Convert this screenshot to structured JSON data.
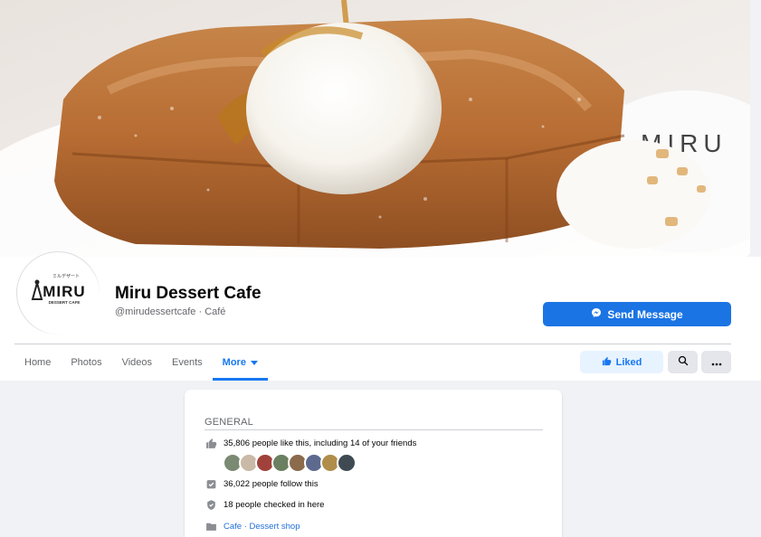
{
  "cover": {
    "plate_text": "MIRU"
  },
  "profile": {
    "logo_text": "MIRU",
    "logo_subtext": "DESSERT CAFE",
    "logo_kana": "ミルデザート",
    "name": "Miru Dessert Cafe",
    "handle": "@mirudessertcafe · Café"
  },
  "actions": {
    "send_message": "Send Message",
    "liked": "Liked",
    "search_icon": "search-icon",
    "more_icon": "more-dots-icon"
  },
  "tabs": [
    {
      "label": "Home"
    },
    {
      "label": "Photos"
    },
    {
      "label": "Videos"
    },
    {
      "label": "Events"
    },
    {
      "label": "More",
      "active": true
    }
  ],
  "about": {
    "title": "GENERAL",
    "likes": "35,806 people like this, including 14 of your friends",
    "follows": "36,022 people follow this",
    "checkins": "18 people checked in here",
    "category_1": "Cafe",
    "category_sep": " · ",
    "category_2": "Dessert shop"
  },
  "colors": {
    "accent": "#1877f2",
    "button_primary": "#1b74e4",
    "liked_bg": "#e7f3ff",
    "page_bg": "#f0f2f5"
  }
}
